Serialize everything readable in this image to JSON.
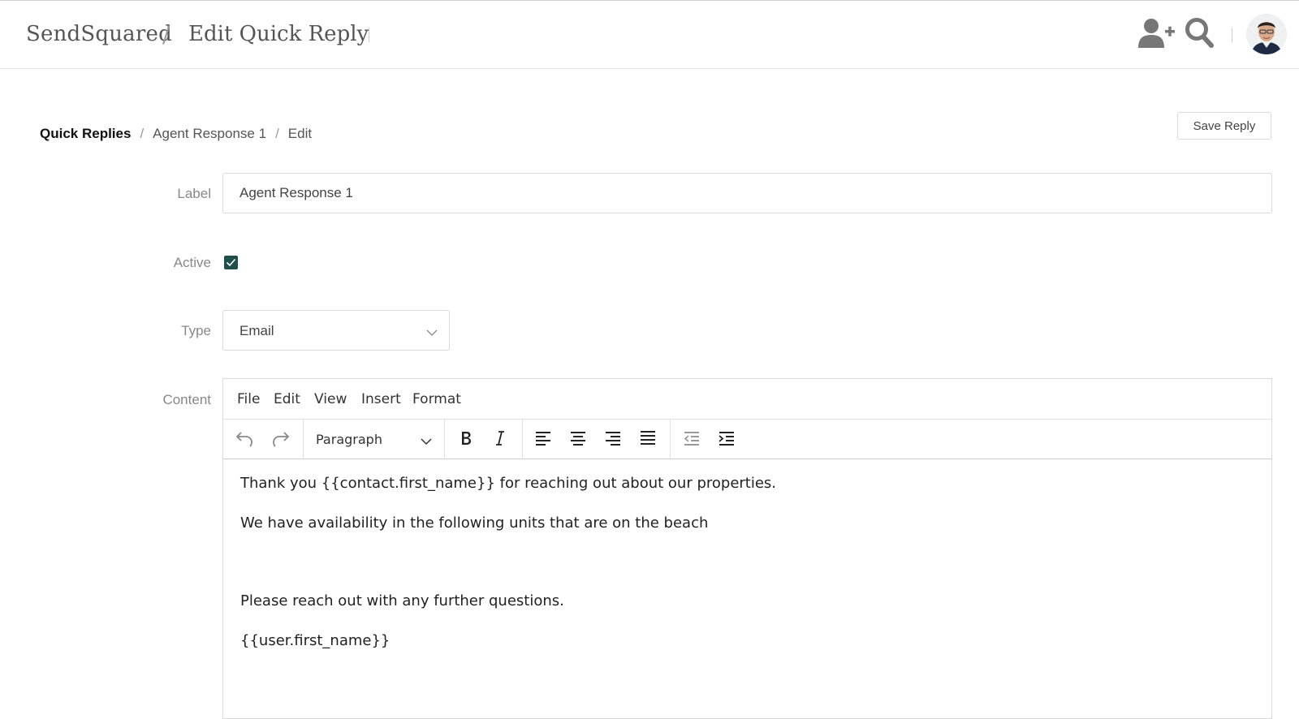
{
  "header": {
    "brand": "SendSquared",
    "separator": "/",
    "title": "Edit Quick Reply"
  },
  "breadcrumb": {
    "root": "Quick Replies",
    "item": "Agent Response 1",
    "current": "Edit",
    "separator": "/"
  },
  "actions": {
    "save_label": "Save Reply"
  },
  "form": {
    "label_label": "Label",
    "label_value": "Agent Response 1",
    "active_label": "Active",
    "active_checked": true,
    "type_label": "Type",
    "type_value": "Email",
    "content_label": "Content"
  },
  "editor": {
    "menu": [
      "File",
      "Edit",
      "View",
      "Insert",
      "Format"
    ],
    "block_format": "Paragraph",
    "paragraphs": [
      "Thank you {{contact.first_name}} for reaching out about our properties.",
      "We have availability in the following units that are on the beach",
      "",
      "Please reach out with any further questions.",
      "{{user.first_name}}"
    ]
  },
  "colors": {
    "checkbox": "#1f4f4a",
    "icon_gray": "#777777"
  }
}
